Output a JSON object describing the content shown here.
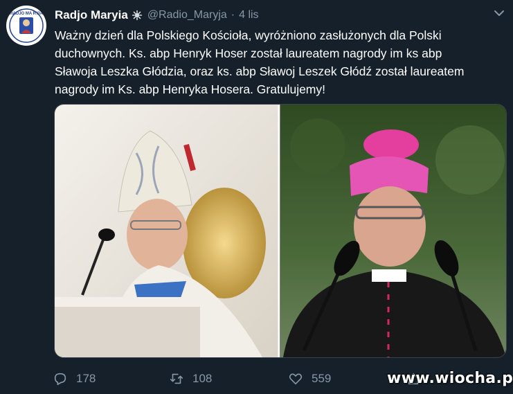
{
  "tweet": {
    "author_name": "Radjo Maryia",
    "handle": "@Radio_Maryja",
    "separator": "·",
    "time": "4 lis",
    "text_lines": [
      "Ważny dzień dla Polskiego Kościoła, wyróżniono zasłużonych dla Polski",
      "duchownych. Ks. abp Henryk Hoser został laureatem nagrody im ks abp",
      "Sławoja Leszka Głódzia, oraz ks. abp Sławoj Leszek Głódź został laureatem",
      "nagrody im Ks. abp Henryka Hosera. Gratulujemy!"
    ]
  },
  "avatar": {
    "logo_text": "RADJO MA RYIA"
  },
  "actions": {
    "replies": "178",
    "retweets": "108",
    "likes": "559"
  },
  "watermark": "www.wiocha.pl",
  "colors": {
    "background": "#15202b",
    "secondary_text": "#8899a6",
    "border": "#38444d"
  },
  "icons": {
    "verified": "verified-badge-icon",
    "menu": "chevron-down-icon",
    "reply": "reply-icon",
    "retweet": "retweet-icon",
    "like": "heart-icon",
    "share": "share-icon"
  }
}
